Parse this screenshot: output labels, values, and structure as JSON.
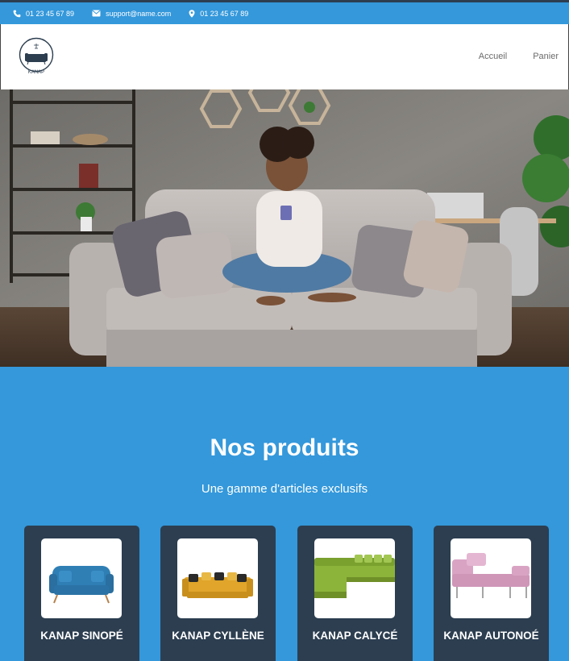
{
  "topbar": {
    "phone_1": "01 23 45 67 89",
    "email": "support@name.com",
    "phone_2": "01 23 45 67 89",
    "icons": [
      "phone-icon",
      "mail-icon",
      "location-pin-icon"
    ]
  },
  "header": {
    "logo_text": "KANAP",
    "nav": {
      "home": "Accueil",
      "cart": "Panier"
    }
  },
  "products": {
    "title": "Nos produits",
    "subtitle": "Une gamme d'articles exclusifs",
    "items": [
      {
        "name": "KANAP SINOPÉ",
        "color": "#2f7fb5"
      },
      {
        "name": "KANAP CYLLÈNE",
        "color": "#e0a52a"
      },
      {
        "name": "KANAP CALYCÉ",
        "color": "#8db43a"
      },
      {
        "name": "KANAP AUTONOÉ",
        "color": "#d9a4c4"
      }
    ]
  },
  "colors": {
    "brand_blue": "#3498db",
    "dark_navy": "#2c3e50"
  }
}
